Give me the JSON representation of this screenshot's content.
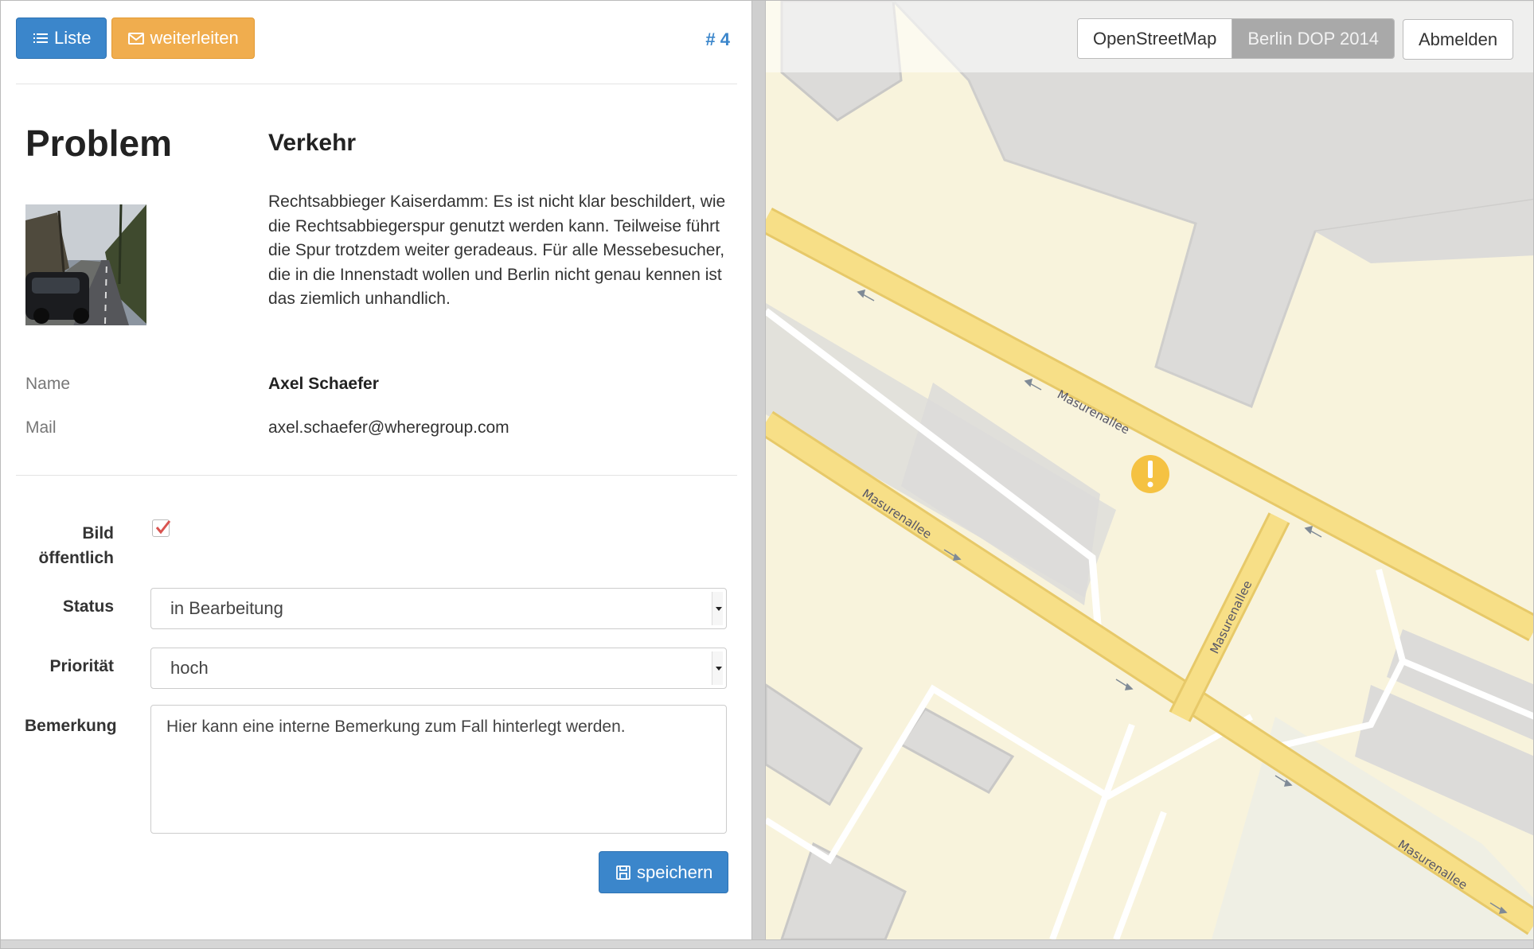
{
  "toolbar": {
    "list_label": "Liste",
    "forward_label": "weiterleiten",
    "case_number": "# 4"
  },
  "problem": {
    "heading": "Problem",
    "category": "Verkehr",
    "description": "Rechtsabbieger Kaiserdamm: Es ist nicht klar beschildert, wie die Rechtsabbiegerspur genutzt werden kann. Teilweise führt die Spur trotzdem weiter geradeaus. Für alle Messebesucher, die in die Innenstadt wollen und Berlin nicht genau kennen ist das ziemlich unhandlich."
  },
  "contact": {
    "name_label": "Name",
    "name_value": "Axel Schaefer",
    "mail_label": "Mail",
    "mail_value": "axel.schaefer@wheregroup.com"
  },
  "form": {
    "public_image_label_line1": "Bild",
    "public_image_label_line2": "öffentlich",
    "public_image_checked": true,
    "status_label": "Status",
    "status_value": "in Bearbeitung",
    "priority_label": "Priorität",
    "priority_value": "hoch",
    "remark_label": "Bemerkung",
    "remark_value": "Hier kann eine interne Bemerkung zum Fall hinterlegt werden.",
    "save_label": "speichern"
  },
  "map": {
    "layers": [
      {
        "label": "OpenStreetMap",
        "active": false
      },
      {
        "label": "Berlin DOP 2014",
        "active": true
      }
    ],
    "logout_label": "Abmelden",
    "street_name": "Masurenallee",
    "marker_icon": "warning-marker-icon",
    "marker_color": "#f5c242"
  },
  "colors": {
    "primary": "#3b86cb",
    "warning": "#f0ad4e",
    "road": "#f7df87",
    "building": "#dcdbd9"
  }
}
